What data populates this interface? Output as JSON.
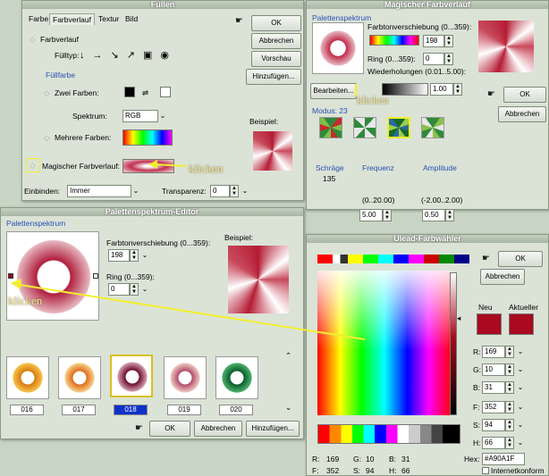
{
  "win1": {
    "title": "Füllen",
    "tabs": [
      "Farbe",
      "Farbverlauf",
      "Textur",
      "Bild"
    ],
    "ok": "OK",
    "cancel": "Abbrechen",
    "preview": "Vorschau",
    "add": "Hinzufügen...",
    "gradient_label": "Farbverlauf",
    "filltype_label": "Fülltyp:",
    "fillcolor_label": "Füllfarbe",
    "two_colors": "Zwei Farben:",
    "spectrum_label": "Spektrum:",
    "spectrum_value": "RGB",
    "multi_colors": "Mehrere Farben:",
    "example_label": "Beispiel:",
    "magic_label": "Magischer Farbverlauf:",
    "click": "klicken",
    "blend_label": "Einbinden:",
    "blend_value": "Immer",
    "transp_label": "Transparenz:",
    "transp_value": "0"
  },
  "win2": {
    "title": "Magischer Farbverlauf",
    "section": "Palettenspektrum",
    "shift_label": "Farbtonverschiebung (0...359):",
    "shift_value": "198",
    "ring_label": "Ring (0...359):",
    "ring_value": "0",
    "repeat_label": "Wiederholungen (0.01..5.00):",
    "repeat_value": "1.00",
    "edit": "Bearbeiten...",
    "click": "klicken",
    "ok": "OK",
    "cancel": "Abbrechen",
    "mode_label": "Modus: 23",
    "slope_label": "Schräge",
    "slope_value": "135",
    "freq_label": "Frequenz",
    "freq_range": "(0..20.00)",
    "freq_value": "5.00",
    "amp_label": "Amplitude",
    "amp_range": "(-2.00..2.00)",
    "amp_value": "0.50"
  },
  "win3": {
    "title": "Palettenspektrum-Editor",
    "section": "Palettenspektrum",
    "shift_label": "Farbtonverschiebung (0...359):",
    "shift_value": "198",
    "ring_label": "Ring (0...359):",
    "ring_value": "0",
    "example_label": "Beispiel:",
    "click": "klicken",
    "presets": [
      "016",
      "017",
      "018",
      "019",
      "020"
    ],
    "ok": "OK",
    "cancel": "Abbrechen",
    "add": "Hinzufügen..."
  },
  "win4": {
    "title": "Ulead-Farbwähler",
    "ok": "OK",
    "cancel": "Abbrechen",
    "new_label": "Neu",
    "current_label": "Aktueller",
    "r_label": "R:",
    "r_value": "169",
    "g_label": "G:",
    "g_value": "10",
    "b_label": "B:",
    "b_value": "31",
    "f_label": "F:",
    "f_value": "352",
    "s_label": "S:",
    "s_value": "94",
    "h_label": "H:",
    "h_value": "66",
    "hex_label": "Hex:",
    "hex_value": "#A90A1F",
    "web_label": "Internetkonform",
    "status_r": "R:",
    "status_r_val": "169",
    "status_g": "G:",
    "status_g_val": "10",
    "status_b": "B:",
    "status_b_val": "31",
    "status_f": "F:",
    "status_f_val": "352",
    "status_s": "S:",
    "status_s_val": "94",
    "status_h": "H:",
    "status_h_val": "66"
  },
  "colors": {
    "selected": "#A90A1F",
    "accent_blue": "#2a4fb8",
    "yellow_arrow": "#f2ee30"
  }
}
